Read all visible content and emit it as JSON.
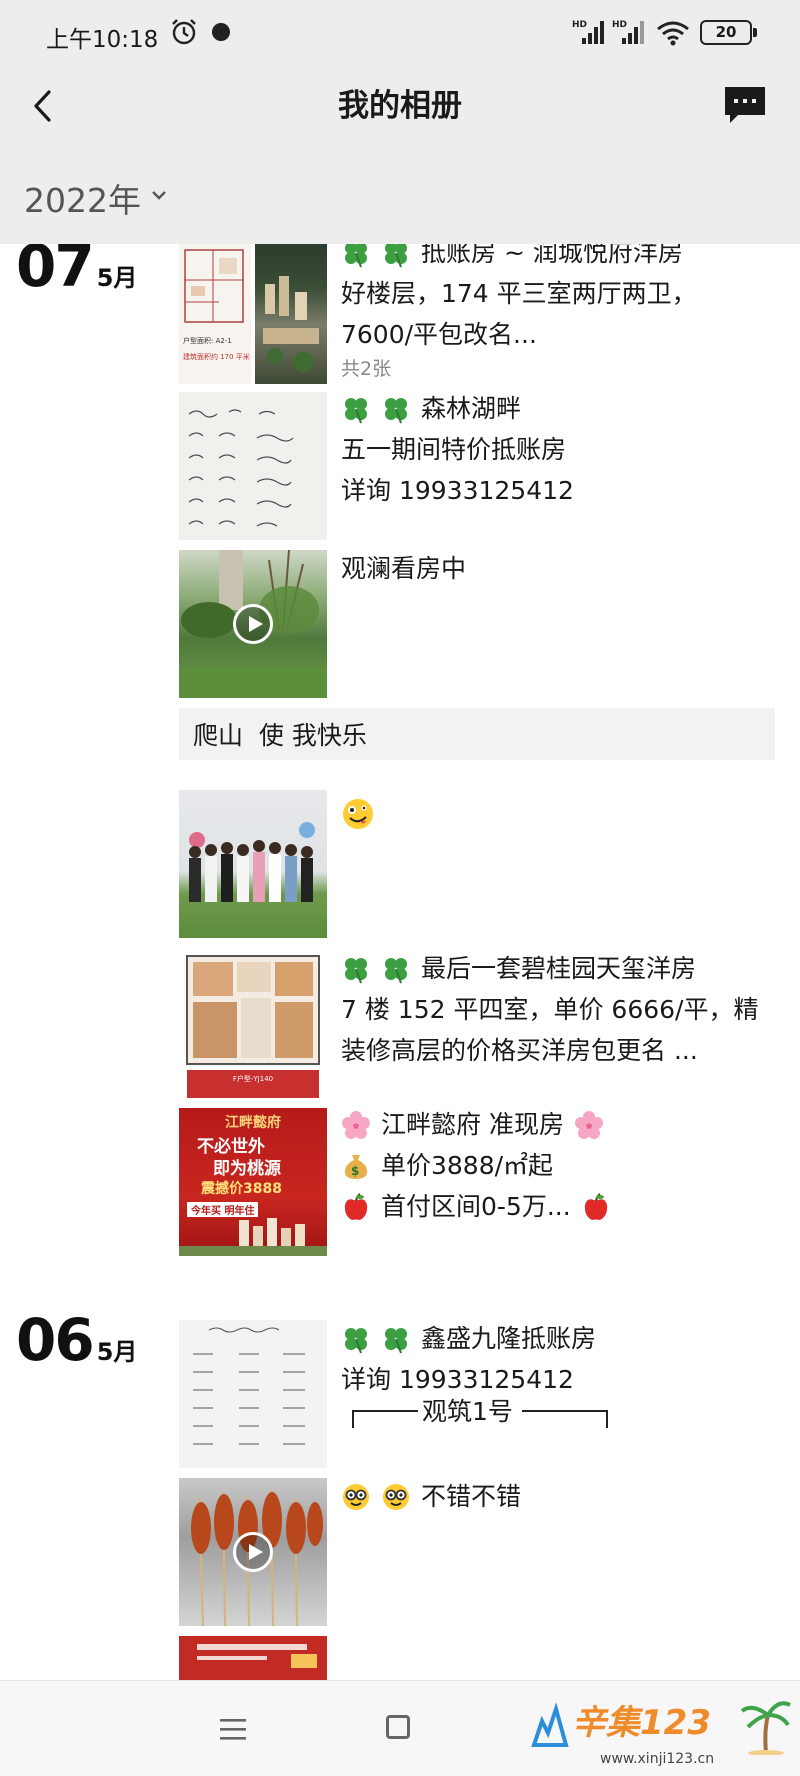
{
  "status_bar": {
    "time": "上午10:18",
    "battery": "20"
  },
  "nav": {
    "title": "我的相册"
  },
  "year_filter": {
    "label": "2022年"
  },
  "groups": [
    {
      "day": "07",
      "month": "5月",
      "posts": [
        {
          "lines": [
            "抵账房 ~ 润城悦府洋房",
            "好楼层，174 平三室两厅两卫，",
            "7600/平包改名..."
          ],
          "count": "共2张"
        },
        {
          "lines": [
            "森林湖畔",
            "五一期间特价抵账房",
            "详询 19933125412"
          ]
        },
        {
          "lines": [
            "观澜看房中"
          ]
        },
        {
          "text_only": "爬山  使 我快乐"
        },
        {
          "lines": []
        },
        {
          "lines": [
            "最后一套碧桂园天玺洋房",
            "7 楼 152 平四室，单价 6666/平，精",
            "装修高层的价格买洋房包更名 ..."
          ]
        },
        {
          "lines": [
            "江畔懿府 准现房",
            "单价3888/㎡起",
            "首付区间0-5万..."
          ]
        }
      ]
    },
    {
      "day": "06",
      "month": "5月",
      "posts": [
        {
          "lines": [
            "鑫盛九隆抵账房",
            "详询 19933125412"
          ]
        },
        {
          "lines": [
            "不错不错"
          ]
        },
        {
          "lines": [
            "观筑1号"
          ]
        }
      ]
    }
  ],
  "thumb_text": {
    "floorplan_label": "户型面积: A2-1",
    "floorplan_area": "建筑面积约 170 平米",
    "fp2_label": "F户型-YJ140",
    "red_title": "江畔懿府",
    "red_slogan1": "不必世外",
    "red_slogan2": "即为桃源",
    "red_price": "震撼价3888",
    "red_banner": "今年买 明年住"
  },
  "watermark": {
    "logo": "辛集123",
    "url": "www.xinji123.cn"
  },
  "colors": {
    "header_bg": "#ededed",
    "leaf": "#3ca043",
    "red_ad": "#b51a1a"
  }
}
